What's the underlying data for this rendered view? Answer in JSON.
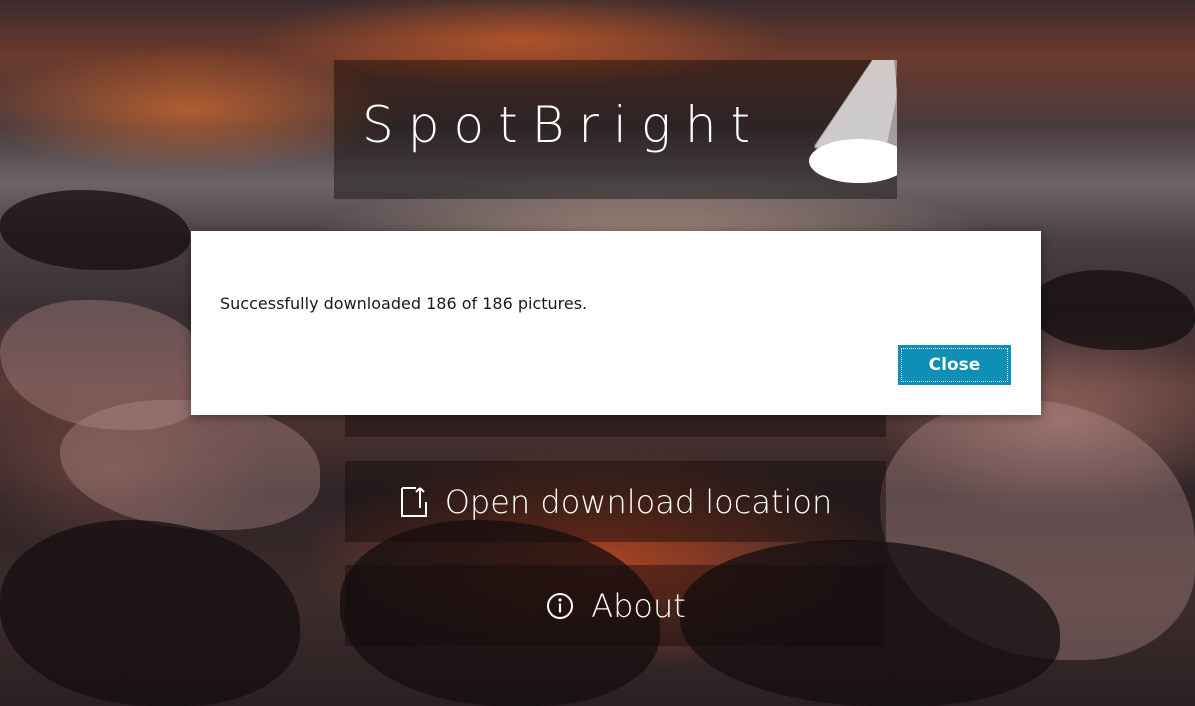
{
  "app": {
    "title": "SpotBright"
  },
  "menu": {
    "open_download_location": "Open download location",
    "about": "About"
  },
  "icons": {
    "spotlight": "spotlight-icon",
    "open_location": "open-folder-icon",
    "about": "info-icon"
  },
  "dialog": {
    "message": "Successfully downloaded 186 of 186 pictures.",
    "close_label": "Close"
  },
  "colors": {
    "accent": "#0e8fb5",
    "dialog_bg": "#ffffff",
    "banner_bg": "rgba(0,0,0,0.38)"
  }
}
